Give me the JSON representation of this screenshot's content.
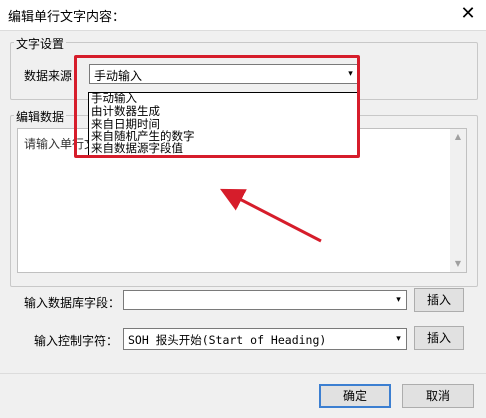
{
  "window": {
    "title": "编辑单行文字内容：",
    "close_glyph": "✕"
  },
  "text_settings": {
    "group_label": "文字设置",
    "source_label": "数据来源：",
    "source_value": "手动输入",
    "dropdown_arrow": "▾",
    "options": [
      "手动输入",
      "由计数器生成",
      "来自日期时间",
      "来自随机产生的数字",
      "来自数据源字段值"
    ]
  },
  "edit_data": {
    "group_label": "编辑数据",
    "placeholder": "请输入单行文",
    "scroll_up": "▲",
    "scroll_down": "▼"
  },
  "db_field": {
    "label": "输入数据库字段：",
    "value": "",
    "arrow": "▾",
    "insert_label": "插入"
  },
  "control_char": {
    "label": "输入控制字符：",
    "value": "SOH  报头开始(Start of Heading)",
    "arrow": "▾",
    "insert_label": "插入"
  },
  "footer": {
    "ok_label": "确定",
    "cancel_label": "取消"
  },
  "colors": {
    "highlight": "#d61d2b",
    "arrow": "#d61d2b",
    "focus_border": "#3c7fd1"
  }
}
